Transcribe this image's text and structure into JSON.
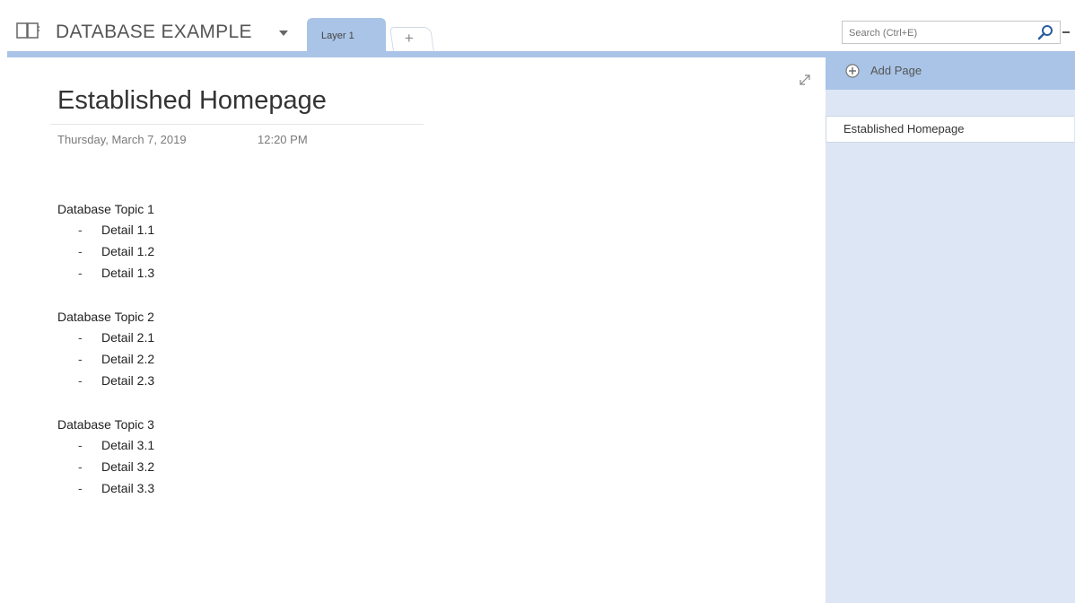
{
  "header": {
    "notebook_title": "DATABASE EXAMPLE",
    "active_tab": "Layer 1",
    "add_tab_label": "+"
  },
  "search": {
    "placeholder": "Search (Ctrl+E)"
  },
  "page": {
    "title": "Established Homepage",
    "date": "Thursday, March 7, 2019",
    "time": "12:20 PM",
    "topics": [
      {
        "title": "Database Topic 1",
        "details": [
          "Detail 1.1",
          "Detail 1.2",
          "Detail 1.3"
        ]
      },
      {
        "title": "Database Topic 2",
        "details": [
          "Detail 2.1",
          "Detail 2.2",
          "Detail 2.3"
        ]
      },
      {
        "title": "Database Topic 3",
        "details": [
          "Detail 3.1",
          "Detail 3.2",
          "Detail 3.3"
        ]
      }
    ],
    "bullet": "-"
  },
  "sidebar": {
    "add_page_label": "Add Page",
    "pages": [
      "Established Homepage"
    ]
  },
  "colors": {
    "accent": "#a9c4e6",
    "pane_bg": "#dce6f4"
  },
  "icons": [
    "notebook-icon",
    "chevron-down-icon",
    "search-icon",
    "expand-icon",
    "add-circle-icon"
  ]
}
